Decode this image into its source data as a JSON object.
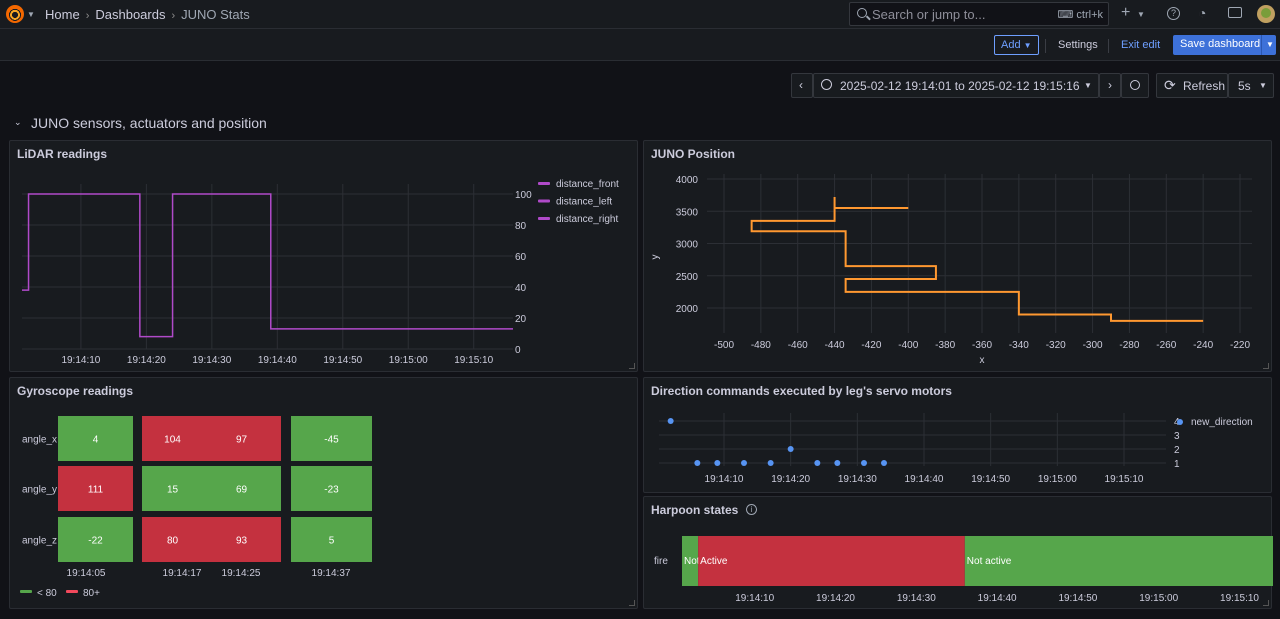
{
  "topbar": {
    "breadcrumbs": [
      "Home",
      "Dashboards",
      "JUNO Stats"
    ],
    "search_placeholder": "Search or jump to...",
    "search_shortcut": "ctrl+k"
  },
  "toolbar": {
    "add_label": "Add",
    "settings_label": "Settings",
    "exit_edit_label": "Exit edit",
    "save_label": "Save dashboard"
  },
  "timepicker": {
    "range": "2025-02-12 19:14:01 to 2025-02-12 19:15:16",
    "refresh_label": "Refresh",
    "interval": "5s"
  },
  "row": {
    "title": "JUNO sensors, actuators and position"
  },
  "panels": {
    "lidar": {
      "title": "LiDAR readings"
    },
    "position": {
      "title": "JUNO Position"
    },
    "gyro": {
      "title": "Gyroscope readings"
    },
    "direction": {
      "title": "Direction commands executed by leg's servo motors"
    },
    "harpoon": {
      "title": "Harpoon states"
    }
  },
  "colors": {
    "purple": "#b04ac9",
    "orange": "#ff9830",
    "blue": "#5794f2",
    "green": "#56a64b",
    "red": "#c4313f"
  },
  "chart_data": [
    {
      "type": "line",
      "title": "LiDAR readings",
      "series": [
        {
          "name": "distance_front",
          "values": []
        },
        {
          "name": "distance_left",
          "values": []
        },
        {
          "name": "distance_right",
          "values": []
        }
      ],
      "legend_position": "right",
      "step_points": [
        [
          "19:14:01",
          38
        ],
        [
          "19:14:02",
          100
        ],
        [
          "19:14:19",
          8
        ],
        [
          "19:14:24",
          100
        ],
        [
          "19:14:39",
          13
        ],
        [
          "19:15:16",
          13
        ]
      ],
      "xticks": [
        "19:14:10",
        "19:14:20",
        "19:14:30",
        "19:14:40",
        "19:14:50",
        "19:15:00",
        "19:15:10"
      ],
      "yticks": [
        0,
        20,
        40,
        60,
        80,
        100
      ],
      "grid": true
    },
    {
      "type": "line",
      "title": "JUNO Position",
      "xlabel": "x",
      "ylabel": "y",
      "points": [
        [
          -400,
          3550
        ],
        [
          -440,
          3550
        ],
        [
          -440,
          3720
        ],
        [
          -440,
          3350
        ],
        [
          -485,
          3350
        ],
        [
          -485,
          3190
        ],
        [
          -434,
          3190
        ],
        [
          -434,
          2650
        ],
        [
          -385,
          2650
        ],
        [
          -385,
          2450
        ],
        [
          -434,
          2450
        ],
        [
          -434,
          2250
        ],
        [
          -340,
          2250
        ],
        [
          -340,
          1900
        ],
        [
          -290,
          1900
        ],
        [
          -290,
          1800
        ],
        [
          -240,
          1800
        ]
      ],
      "xticks": [
        -500,
        -480,
        -460,
        -440,
        -420,
        -400,
        -380,
        -360,
        -340,
        -320,
        -300,
        -280,
        -260,
        -240,
        -220
      ],
      "yticks": [
        2000,
        2500,
        3000,
        3500,
        4000
      ],
      "grid": true
    },
    {
      "type": "heatmap",
      "title": "Gyroscope readings",
      "rows": [
        "angle_x",
        "angle_y",
        "angle_z"
      ],
      "columns": [
        "19:14:05",
        "19:14:17",
        "19:14:25",
        "19:14:37"
      ],
      "values": [
        [
          4,
          104,
          97,
          -45
        ],
        [
          111,
          15,
          69,
          -23
        ],
        [
          -22,
          80,
          93,
          5
        ]
      ],
      "legend": [
        "< 80",
        "80+"
      ]
    },
    {
      "type": "scatter",
      "title": "Direction commands executed by leg's servo motors",
      "series": [
        {
          "name": "new_direction",
          "points": [
            [
              "19:14:02",
              4
            ],
            [
              "19:14:06",
              1
            ],
            [
              "19:14:09",
              1
            ],
            [
              "19:14:13",
              1
            ],
            [
              "19:14:17",
              1
            ],
            [
              "19:14:20",
              2
            ],
            [
              "19:14:24",
              1
            ],
            [
              "19:14:27",
              1
            ],
            [
              "19:14:31",
              1
            ],
            [
              "19:14:34",
              1
            ]
          ]
        }
      ],
      "xticks": [
        "19:14:10",
        "19:14:20",
        "19:14:30",
        "19:14:40",
        "19:14:50",
        "19:15:00",
        "19:15:10"
      ],
      "yticks": [
        1,
        2,
        3,
        4
      ]
    },
    {
      "type": "table",
      "title": "Harpoon states",
      "row": "fire",
      "states": [
        {
          "label": "Not",
          "from": "19:14:01",
          "to": "19:14:03",
          "color": "green"
        },
        {
          "label": "Active",
          "from": "19:14:03",
          "to": "19:14:36",
          "color": "red"
        },
        {
          "label": "Not active",
          "from": "19:14:36",
          "to": "19:15:16",
          "color": "green"
        }
      ],
      "xticks": [
        "19:14:10",
        "19:14:20",
        "19:14:30",
        "19:14:40",
        "19:14:50",
        "19:15:00",
        "19:15:10"
      ]
    }
  ]
}
